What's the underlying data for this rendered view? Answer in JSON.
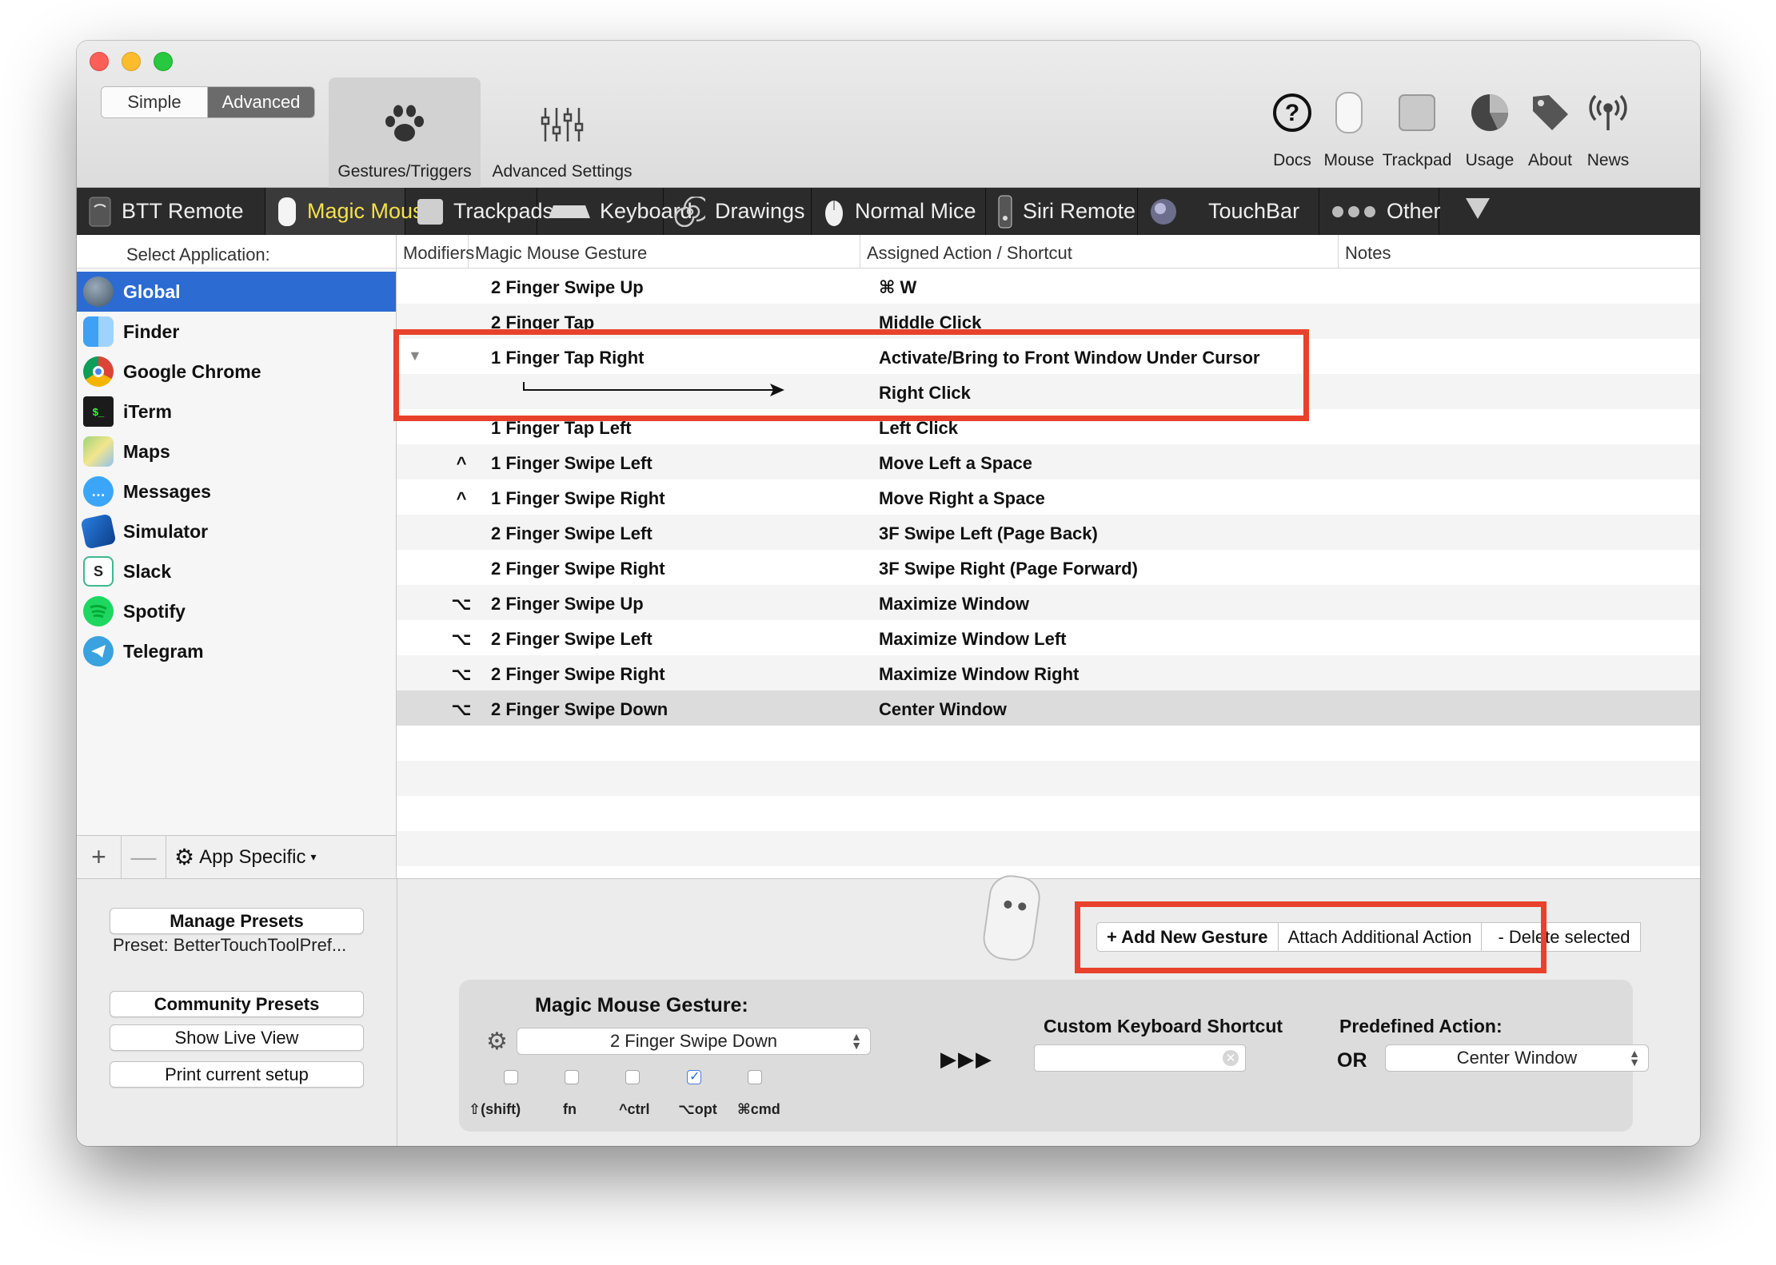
{
  "toolbar": {
    "seg_simple": "Simple",
    "seg_advanced": "Advanced",
    "tab_gestures": "Gestures/Triggers",
    "tab_advanced_settings": "Advanced Settings",
    "docs": "Docs",
    "mouse": "Mouse",
    "trackpad": "Trackpad",
    "usage": "Usage",
    "about": "About",
    "news": "News"
  },
  "devices": [
    "BTT Remote",
    "Magic Mouse",
    "Trackpads",
    "Keyboard",
    "Drawings",
    "Normal Mice",
    "Siri Remote",
    "TouchBar",
    "Other"
  ],
  "sidebar": {
    "header": "Select Application:",
    "apps": [
      "Global",
      "Finder",
      "Google Chrome",
      "iTerm",
      "Maps",
      "Messages",
      "Simulator",
      "Slack",
      "Spotify",
      "Telegram"
    ],
    "add": "+",
    "remove": "—",
    "app_specific": "App Specific"
  },
  "table": {
    "col_modifiers": "Modifiers",
    "col_gesture": "Magic Mouse Gesture",
    "col_action": "Assigned Action / Shortcut",
    "col_notes": "Notes",
    "rows": [
      {
        "mod": "",
        "gesture": "2 Finger Swipe Up",
        "action": "⌘ W"
      },
      {
        "mod": "",
        "gesture": "2 Finger Tap",
        "action": "Middle Click"
      },
      {
        "mod": "",
        "gesture": "1 Finger Tap Right",
        "action": "Activate/Bring to Front Window Under Cursor"
      },
      {
        "mod": "",
        "gesture": "",
        "action": "Right Click"
      },
      {
        "mod": "",
        "gesture": "1 Finger Tap Left",
        "action": "Left Click"
      },
      {
        "mod": "^",
        "gesture": "1 Finger Swipe Left",
        "action": "Move Left a Space"
      },
      {
        "mod": "^",
        "gesture": "1 Finger Swipe Right",
        "action": "Move Right a Space"
      },
      {
        "mod": "",
        "gesture": "2 Finger Swipe Left",
        "action": "3F Swipe Left (Page Back)"
      },
      {
        "mod": "",
        "gesture": "2 Finger Swipe Right",
        "action": "3F Swipe Right (Page Forward)"
      },
      {
        "mod": "⌥",
        "gesture": "2 Finger Swipe Up",
        "action": "Maximize Window"
      },
      {
        "mod": "⌥",
        "gesture": "2 Finger Swipe Left",
        "action": "Maximize Window Left"
      },
      {
        "mod": "⌥",
        "gesture": "2 Finger Swipe Right",
        "action": "Maximize Window Right"
      },
      {
        "mod": "⌥",
        "gesture": "2 Finger Swipe Down",
        "action": "Center Window"
      }
    ]
  },
  "actions": {
    "add_gesture": "+ Add New Gesture",
    "attach_action": "Attach Additional Action",
    "delete_selected": "- Delete selected"
  },
  "presets": {
    "manage": "Manage Presets",
    "preset_label": "Preset: BetterTouchToolPref...",
    "community": "Community Presets",
    "live_view": "Show Live View",
    "print_setup": "Print current setup"
  },
  "editor": {
    "title": "Magic Mouse Gesture:",
    "gesture_value": "2 Finger Swipe Down",
    "arrows": "▶▶▶",
    "shortcut_label": "Custom Keyboard Shortcut",
    "or": "OR",
    "predefined_label": "Predefined Action:",
    "predefined_value": "Center Window",
    "modifiers": [
      {
        "label": "⇧(shift)",
        "checked": false
      },
      {
        "label": "fn",
        "checked": false
      },
      {
        "label": "^ctrl",
        "checked": false
      },
      {
        "label": "⌥opt",
        "checked": true
      },
      {
        "label": "⌘cmd",
        "checked": false
      }
    ]
  },
  "colors": {
    "selection": "#2b6bd2",
    "highlight_box": "#e8412c",
    "device_bar": "#2b2b2b",
    "active_device_text": "#f5e14a"
  }
}
